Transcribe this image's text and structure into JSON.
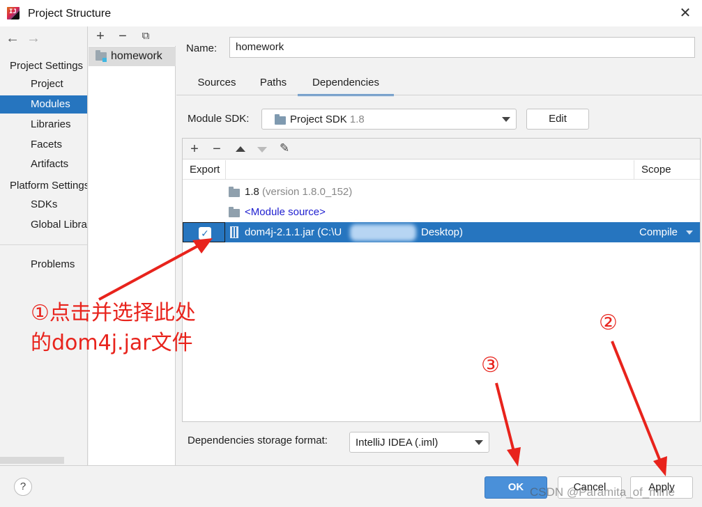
{
  "window": {
    "title": "Project Structure",
    "close_glyph": "✕"
  },
  "sidebar": {
    "back_glyph": "←",
    "forward_glyph": "→",
    "project_settings_header": "Project Settings",
    "platform_settings_header": "Platform Settings",
    "items": [
      {
        "label": "Project"
      },
      {
        "label": "Modules"
      },
      {
        "label": "Libraries"
      },
      {
        "label": "Facets"
      },
      {
        "label": "Artifacts"
      },
      {
        "label": "SDKs"
      },
      {
        "label": "Global Libraries"
      },
      {
        "label": "Problems"
      }
    ],
    "selected": "Modules"
  },
  "modules": {
    "toolbar": {
      "add": "+",
      "remove": "−",
      "copy": "⧉"
    },
    "items": [
      {
        "label": "homework"
      }
    ]
  },
  "main": {
    "name_label": "Name:",
    "name_value": "homework",
    "tabs": [
      {
        "label": "Sources"
      },
      {
        "label": "Paths"
      },
      {
        "label": "Dependencies"
      }
    ],
    "active_tab": "Dependencies",
    "sdk_label": "Module SDK:",
    "sdk_value": "Project SDK",
    "sdk_version": "1.8",
    "edit_button": "Edit",
    "dep_toolbar": {
      "add": "+",
      "remove": "−",
      "edit": "✎"
    },
    "columns": {
      "export": "Export",
      "scope": "Scope"
    },
    "rows": [
      {
        "name": "1.8",
        "detail": "(version 1.8.0_152)"
      },
      {
        "name": "<Module source>"
      },
      {
        "name_start": "dom4j-2.1.1.jar (C:\\U",
        "name_end": "Desktop)",
        "scope": "Compile",
        "checked": true
      }
    ],
    "storage_format_label": "Dependencies storage format:",
    "storage_format_value": "IntelliJ IDEA (.iml)"
  },
  "footer": {
    "help": "?",
    "ok": "OK",
    "cancel": "Cancel",
    "apply": "Apply"
  },
  "annotations": {
    "step1_line1": "①点击并选择此处",
    "step1_line2": "的dom4j.jar文件",
    "step2": "②",
    "step3": "③",
    "color": "#e8231c"
  },
  "watermark": "CSDN @Paramita_of_mine"
}
